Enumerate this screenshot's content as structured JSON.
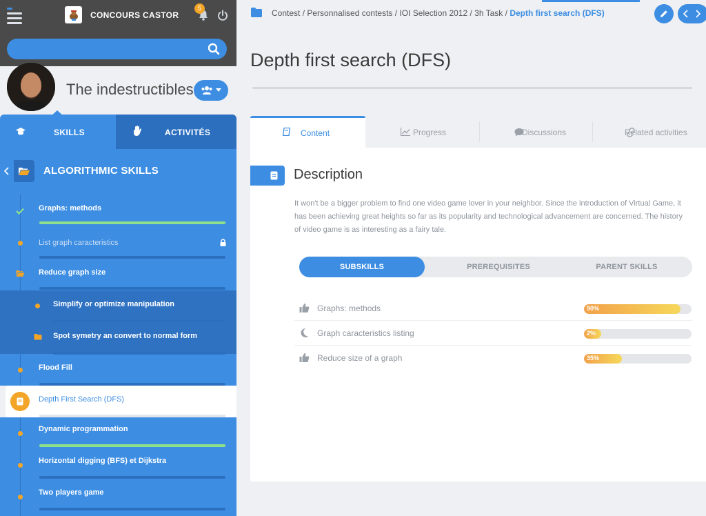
{
  "app": {
    "title": "CONCOURS CASTOR",
    "notifications_count": "5"
  },
  "sidebar": {
    "search": {
      "placeholder": "",
      "value": ""
    },
    "team_name": "The indestructibles",
    "tabs": [
      {
        "label": "SKILLS",
        "active": true
      },
      {
        "label": "ACTIVITÉS",
        "active": false
      }
    ],
    "section_title": "ALGORITHMIC SKILLS",
    "items": [
      {
        "label": "Graphs: methods",
        "status": "done",
        "progress": 1.0
      },
      {
        "label": "List graph caracteristics",
        "status": "locked",
        "progress": 0
      },
      {
        "label": "Reduce graph size",
        "status": "open-folder",
        "progress": 0
      },
      {
        "label": "Simplify or optimize manipulation",
        "status": "sub",
        "progress": 0
      },
      {
        "label": "Spot symetry an convert to normal form",
        "status": "sub-folder",
        "progress": 0
      },
      {
        "label": "Flood Fill",
        "status": "todo",
        "progress": 0
      },
      {
        "label": "Depth First Search (DFS)",
        "status": "active",
        "progress": 0
      },
      {
        "label": "Dynamic programmation",
        "status": "done",
        "progress": 1.0
      },
      {
        "label": "Horizontal digging (BFS) et Dijkstra",
        "status": "todo",
        "progress": 0
      },
      {
        "label": "Two players game",
        "status": "todo",
        "progress": 0
      }
    ]
  },
  "breadcrumb": {
    "path": "Contest / Personnalised contests / IOI Selection 2012 / 3h Task /",
    "current": "Depth first search (DFS)"
  },
  "page": {
    "title": "Depth first search (DFS)"
  },
  "tabs": [
    {
      "label": "Content",
      "icon": "book-icon",
      "active": true
    },
    {
      "label": "Progress",
      "icon": "chart-icon",
      "active": false
    },
    {
      "label": "Discussions",
      "icon": "chat-icon",
      "active": false
    },
    {
      "label": "Related activities",
      "icon": "link-icon",
      "active": false
    }
  ],
  "description": {
    "title": "Description",
    "text": "It won't be a bigger problem to find one video game lover in your neighbor. Since the introduction of Virtual Game, it has been achieving great heights so far as its popularity and technological advancement are concerned. The history of video game is as interesting as a fairy tale."
  },
  "segments": [
    {
      "label": "SUBSKILLS",
      "active": true
    },
    {
      "label": "PREREQUISITES",
      "active": false
    },
    {
      "label": "PARENT SKILLS",
      "active": false
    }
  ],
  "subskills": [
    {
      "name": "Graphs: methods",
      "icon": "thumbs-up-icon",
      "percent_label": "90%",
      "progress": 0.9
    },
    {
      "name": "Graph caracteristics listing",
      "icon": "moon-icon",
      "percent_label": "2%",
      "progress": 0.02
    },
    {
      "name": "Reduce size of a graph",
      "icon": "thumbs-up-icon",
      "percent_label": "35%",
      "progress": 0.35
    }
  ],
  "colors": {
    "accent": "#3d8ee3",
    "accent_dark": "#2d6fbf",
    "orange": "#f2a526",
    "green": "#8fe08a",
    "topbar": "#4a4a4a"
  }
}
